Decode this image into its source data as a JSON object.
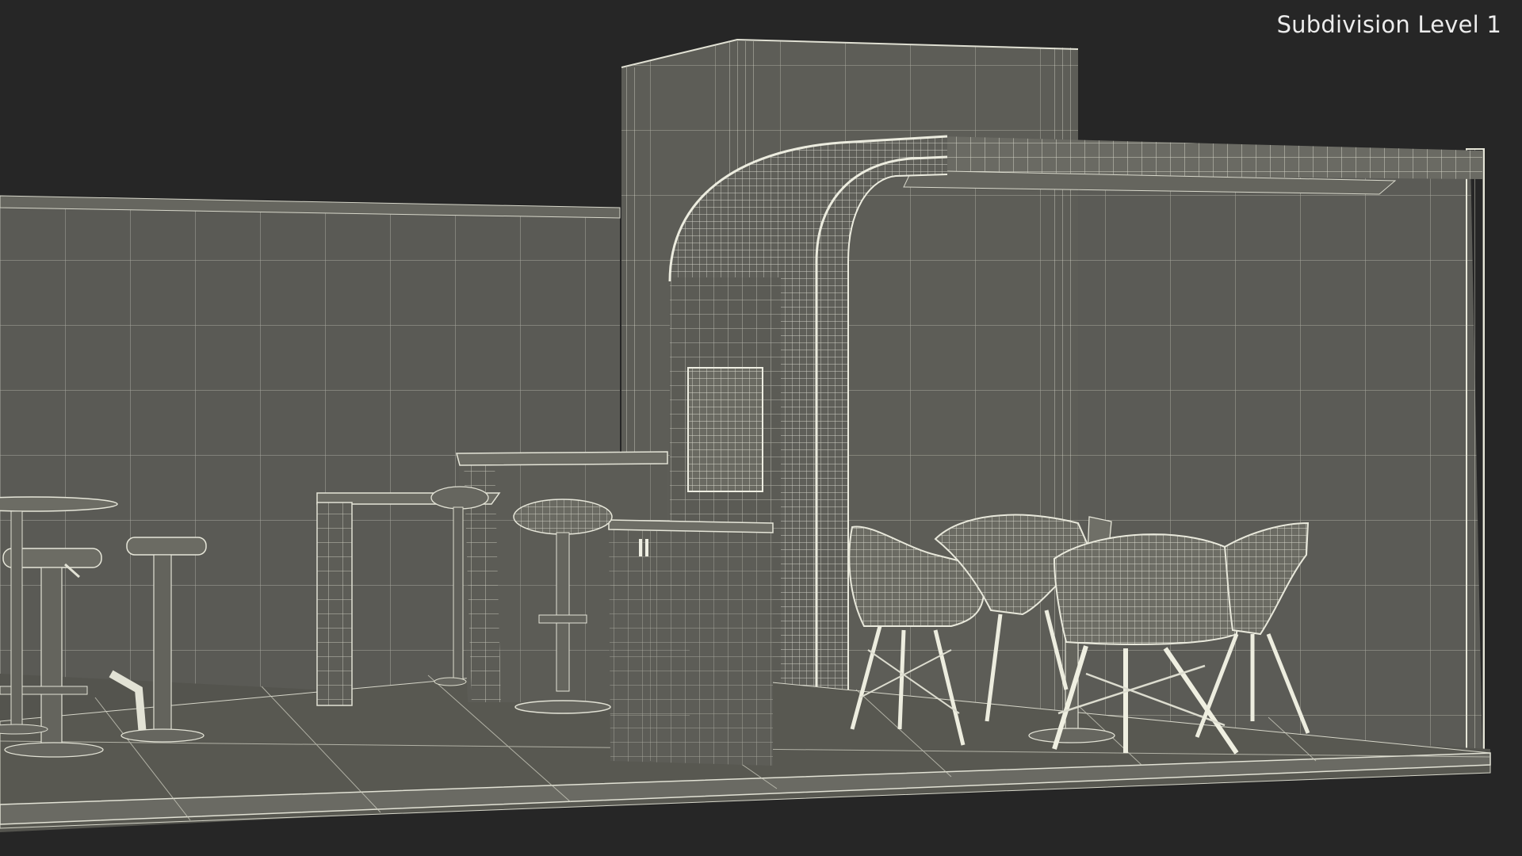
{
  "viewport": {
    "overlay_label": "Subdivision Level 1"
  },
  "colors": {
    "background": "#262626",
    "wall_fill": "#5b5b56",
    "wall_fill_dark": "#4f4f4a",
    "floor_fill": "#56564f",
    "wire": "#d9d9cc",
    "wire_light": "#eeeee2",
    "overlay_text": "#ececec"
  },
  "scene_objects": [
    "back-wall",
    "tower-wall",
    "curved-canopy",
    "roof-beam",
    "right-side-wall",
    "floor-platform",
    "bar-counter",
    "high-table",
    "storage-cabinet",
    "wall-panel-screen",
    "bar-stools",
    "armchairs",
    "round-table",
    "laptop"
  ]
}
